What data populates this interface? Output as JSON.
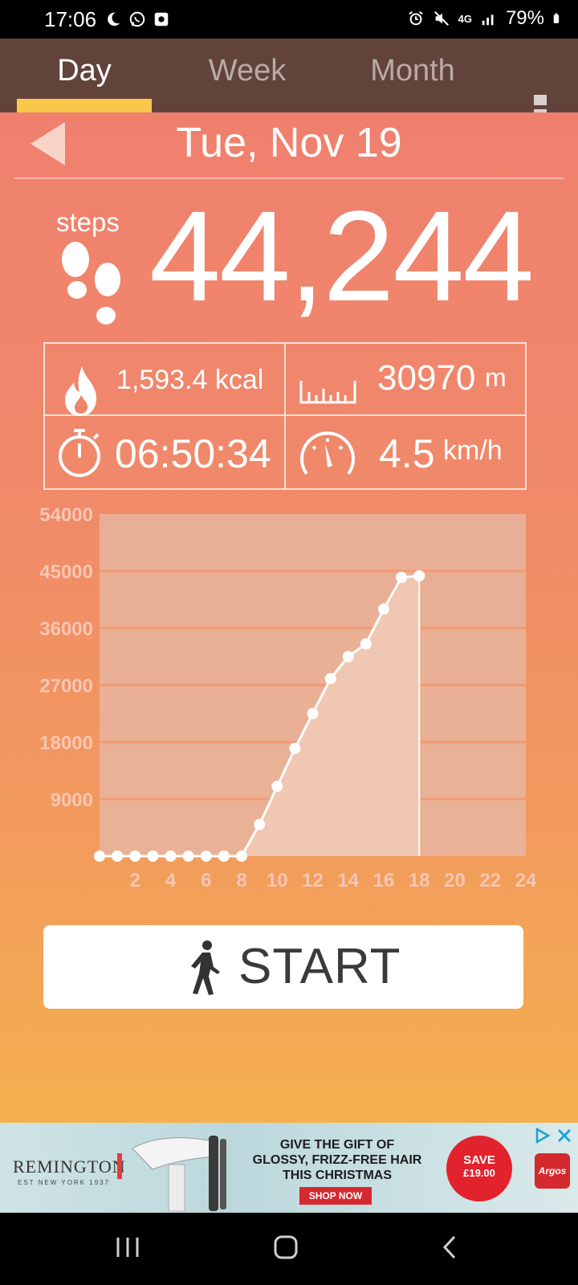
{
  "status_bar": {
    "time": "17:06",
    "left_icons": [
      "moon-icon",
      "whatsapp-icon",
      "app-notification-icon"
    ],
    "network": "4G",
    "battery": "79%"
  },
  "tabs": [
    {
      "label": "Day",
      "active": true
    },
    {
      "label": "Week",
      "active": false
    },
    {
      "label": "Month",
      "active": false
    }
  ],
  "date": "Tue, Nov 19",
  "steps": {
    "label": "steps",
    "count": "44,244"
  },
  "stats": {
    "calories": "1,593.4 kcal",
    "distance_value": "30970",
    "distance_unit": "m",
    "duration": "06:50:34",
    "speed_value": "4.5",
    "speed_unit": "km/h"
  },
  "chart_data": {
    "type": "area",
    "x": [
      0,
      1,
      2,
      3,
      4,
      5,
      6,
      7,
      8,
      9,
      10,
      11,
      12,
      13,
      14,
      15,
      16,
      17,
      18
    ],
    "values": [
      0,
      0,
      0,
      0,
      0,
      0,
      0,
      0,
      0,
      5000,
      11000,
      17000,
      22500,
      28000,
      31500,
      33500,
      39000,
      44000,
      44244
    ],
    "xticks": [
      "2",
      "4",
      "6",
      "8",
      "10",
      "12",
      "14",
      "16",
      "18",
      "20",
      "22",
      "24"
    ],
    "yticks": [
      "54000",
      "45000",
      "36000",
      "27000",
      "18000",
      "9000"
    ],
    "xlim": [
      0,
      24
    ],
    "ylim": [
      0,
      54000
    ],
    "grid": true,
    "colors": {
      "line": "#ffffff",
      "fill": "#f0c8b4",
      "plot_bg": "#e8b59f",
      "grid": "#f29a73",
      "tick": "#f7c6b3"
    }
  },
  "start_button": {
    "label": "START"
  },
  "ad": {
    "brand": "REMINGTON",
    "brand_sub": "EST NEW YORK 1937",
    "headline_1": "GIVE THE GIFT OF",
    "headline_2": "GLOSSY, FRIZZ-FREE HAIR",
    "headline_3": "THIS CHRISTMAS",
    "cta": "SHOP NOW",
    "save_1": "SAVE",
    "save_2": "£19.00",
    "retailer": "Argos"
  }
}
